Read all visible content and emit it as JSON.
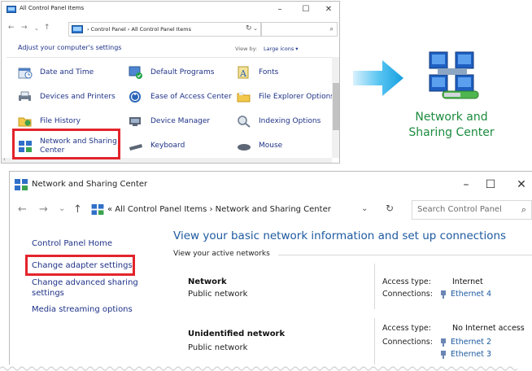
{
  "control_panel": {
    "title": "All Control Panel Items",
    "window_controls": {
      "minimize": "–",
      "maximize": "☐",
      "close": "✕"
    },
    "address": {
      "crumbs": "›  Control Panel  ›  All Control Panel Items",
      "dropdown": "⌄",
      "refresh": "↻"
    },
    "nav": {
      "back": "←",
      "forward": "→",
      "recent": "⌄",
      "up": "↑"
    },
    "search_icon": "⌕",
    "adjust_text": "Adjust your computer's settings",
    "view_by_label": "View by:",
    "view_by_value": "Large icons ▾",
    "items": [
      {
        "label": "Date and Time",
        "icon": "date-time-icon"
      },
      {
        "label": "Default Programs",
        "icon": "default-programs-icon"
      },
      {
        "label": "Fonts",
        "icon": "fonts-icon"
      },
      {
        "label": "Devices and Printers",
        "icon": "devices-printers-icon"
      },
      {
        "label": "Ease of Access Center",
        "icon": "ease-of-access-icon"
      },
      {
        "label": "File Explorer Options",
        "icon": "file-explorer-options-icon"
      },
      {
        "label": "File History",
        "icon": "file-history-icon"
      },
      {
        "label": "Device Manager",
        "icon": "device-manager-icon"
      },
      {
        "label": "Indexing Options",
        "icon": "indexing-options-icon"
      },
      {
        "label": "Network and Sharing\nCenter",
        "icon": "network-sharing-icon"
      },
      {
        "label": "Keyboard",
        "icon": "keyboard-icon"
      },
      {
        "label": "Mouse",
        "icon": "mouse-icon"
      }
    ]
  },
  "callout": {
    "caption": "Network and\nSharing Center",
    "arrow_color": "#1aa5e4",
    "caption_color": "#1c8b3f",
    "highlight_color": "#e3242b"
  },
  "network_center": {
    "title": "Network and Sharing Center",
    "window_controls": {
      "minimize": "–",
      "maximize": "☐",
      "close": "✕"
    },
    "nav": {
      "back": "←",
      "forward": "→",
      "recent": "⌄",
      "up": "↑"
    },
    "address": {
      "crumbs": "«  All Control Panel Items  ›  Network and Sharing Center",
      "dropdown": "⌄",
      "refresh": "↻"
    },
    "search_placeholder": "Search Control Panel",
    "search_icon": "⌕",
    "sidebar": {
      "home": "Control Panel Home",
      "adapter": "Change adapter settings",
      "advanced": "Change advanced sharing\nsettings",
      "media": "Media streaming options"
    },
    "heading": "View your basic network information and set up connections",
    "active_networks_label": "View your active networks",
    "networks": [
      {
        "name": "Network",
        "type": "Public network",
        "access_type_label": "Access type:",
        "access_type": "Internet",
        "connections_label": "Connections:",
        "connections": [
          "Ethernet 4"
        ]
      },
      {
        "name": "Unidentified network",
        "type": "Public network",
        "access_type_label": "Access type:",
        "access_type": "No Internet access",
        "connections_label": "Connections:",
        "connections": [
          "Ethernet 2",
          "Ethernet 3"
        ]
      }
    ]
  }
}
